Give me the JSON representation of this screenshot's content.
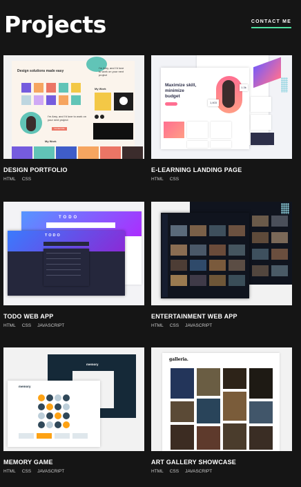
{
  "header": {
    "title": "Projects",
    "contact_label": "CONTACT ME"
  },
  "projects": [
    {
      "title": "DESIGN PORTFOLIO",
      "tags": [
        "HTML",
        "CSS"
      ]
    },
    {
      "title": "E-LEARNING LANDING PAGE",
      "tags": [
        "HTML",
        "CSS"
      ]
    },
    {
      "title": "TODO WEB APP",
      "tags": [
        "HTML",
        "CSS",
        "JAVASCRIPT"
      ]
    },
    {
      "title": "ENTERTAINMENT WEB APP",
      "tags": [
        "HTML",
        "CSS",
        "JAVASCRIPT"
      ]
    },
    {
      "title": "MEMORY GAME",
      "tags": [
        "HTML",
        "CSS",
        "JAVASCRIPT"
      ]
    },
    {
      "title": "ART GALLERY SHOWCASE",
      "tags": [
        "HTML",
        "CSS",
        "JAVASCRIPT"
      ]
    }
  ],
  "thumbnails": {
    "design_portfolio": {
      "headline": "Design solutions made easy",
      "intro": "I'm Amy, and I'd love to work on your next project",
      "cta": "Contact Me",
      "section": "My Work"
    },
    "elearning": {
      "headline": "Maximize skill, minimize budget",
      "stat": "1,403",
      "stat2": "1.3k"
    },
    "todo": {
      "heading": "TODO"
    },
    "memory": {
      "heading": "memory"
    },
    "gallery": {
      "heading": "galleria."
    }
  },
  "colors": {
    "accent": "#4ee1a0",
    "background": "#151515"
  }
}
